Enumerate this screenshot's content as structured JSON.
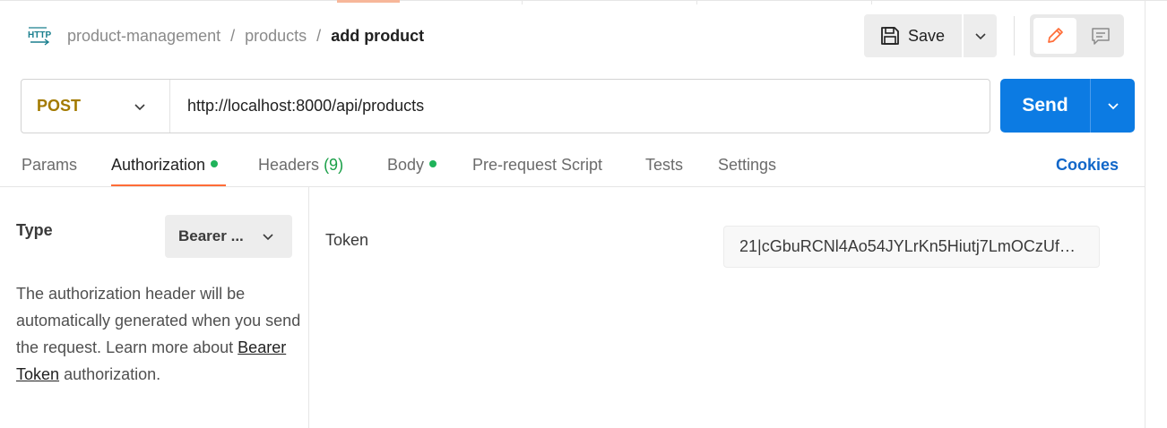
{
  "header": {
    "protocol_icon": "http-icon",
    "breadcrumb": [
      "product-management",
      "products",
      "add product"
    ],
    "separator": "/",
    "save_label": "Save"
  },
  "request": {
    "method": "POST",
    "url": "http://localhost:8000/api/products",
    "send_label": "Send"
  },
  "tabs": [
    {
      "label": "Params"
    },
    {
      "label": "Authorization",
      "active": true,
      "indicator": true
    },
    {
      "label": "Headers",
      "count": "(9)"
    },
    {
      "label": "Body",
      "indicator": true
    },
    {
      "label": "Pre-request Script"
    },
    {
      "label": "Tests"
    },
    {
      "label": "Settings"
    }
  ],
  "cookies_label": "Cookies",
  "auth": {
    "type_label": "Type",
    "type_value": "Bearer ...",
    "description_text": "The authorization header will be automatically generated when you send the request. Learn more about",
    "link_text": "Bearer Token",
    "description_suffix": "authorization.",
    "token_label": "Token",
    "token_value": "21|cGbuRCNl4Ao54JYLrKn5Hiutj7LmOCzUf…"
  },
  "colors": {
    "accent": "#ff6c37",
    "send": "#0c7be3",
    "method": "#a37a00",
    "indicator": "#1fb35a",
    "link": "#1167c9"
  }
}
